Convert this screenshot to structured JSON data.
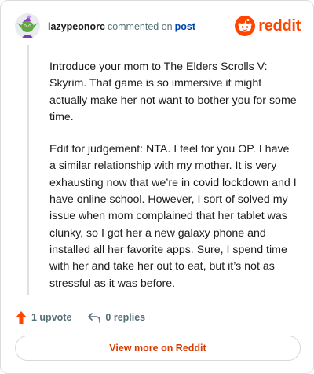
{
  "header": {
    "username": "lazypeonorc",
    "verb": "commented on",
    "target_link": "post",
    "brand_word": "reddit"
  },
  "comment": {
    "paragraphs": [
      "Introduce your mom to The Elders Scrolls V: Skyrim. That game is so immersive it might actually make her not want to bother you for some time.",
      "Edit for judgement: NTA. I feel for you OP. I have a similar relationship with my mother. It is very exhausting now that we’re in covid lockdown and I have online school. However, I sort of solved my issue when mom complained that her tablet was clunky, so I got her a new galaxy phone and installed all her favorite apps. Sure, I spend time with her and take her out to eat, but it’s not as stressful as it was before."
    ]
  },
  "actions": {
    "upvote_label": "1 upvote",
    "replies_label": "0 replies"
  },
  "footer": {
    "view_more_label": "View more on Reddit"
  },
  "icons": {
    "avatar": "snoo-avatar-icon",
    "brand": "reddit-logo-icon",
    "upvote": "upvote-arrow-icon",
    "reply": "reply-arrow-icon"
  },
  "colors": {
    "brand_orange": "#ff4500",
    "link_blue": "#0045ac",
    "view_more": "#d93a00",
    "muted": "#576f76"
  }
}
